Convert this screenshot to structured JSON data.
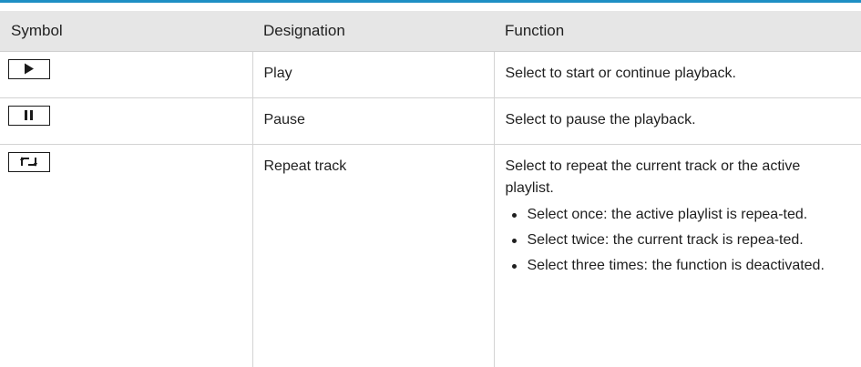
{
  "table": {
    "headers": {
      "symbol": "Symbol",
      "designation": "Designation",
      "function": "Function"
    },
    "rows": [
      {
        "icon": "play-icon",
        "designation": "Play",
        "function": "Select to start or continue playback."
      },
      {
        "icon": "pause-icon",
        "designation": "Pause",
        "function": "Select to pause the playback."
      },
      {
        "icon": "repeat-icon",
        "designation": "Repeat track",
        "function": "Select to repeat the current track or the active playlist.",
        "bullets": [
          "Select once: the active playlist is repea-ted.",
          "Select twice: the current track is repea-ted.",
          "Select three times: the function is deactivated."
        ]
      }
    ]
  },
  "colors": {
    "top_rule": "#1e8fc4",
    "header_bg": "#e6e6e6",
    "grid": "#d3d3d3"
  }
}
